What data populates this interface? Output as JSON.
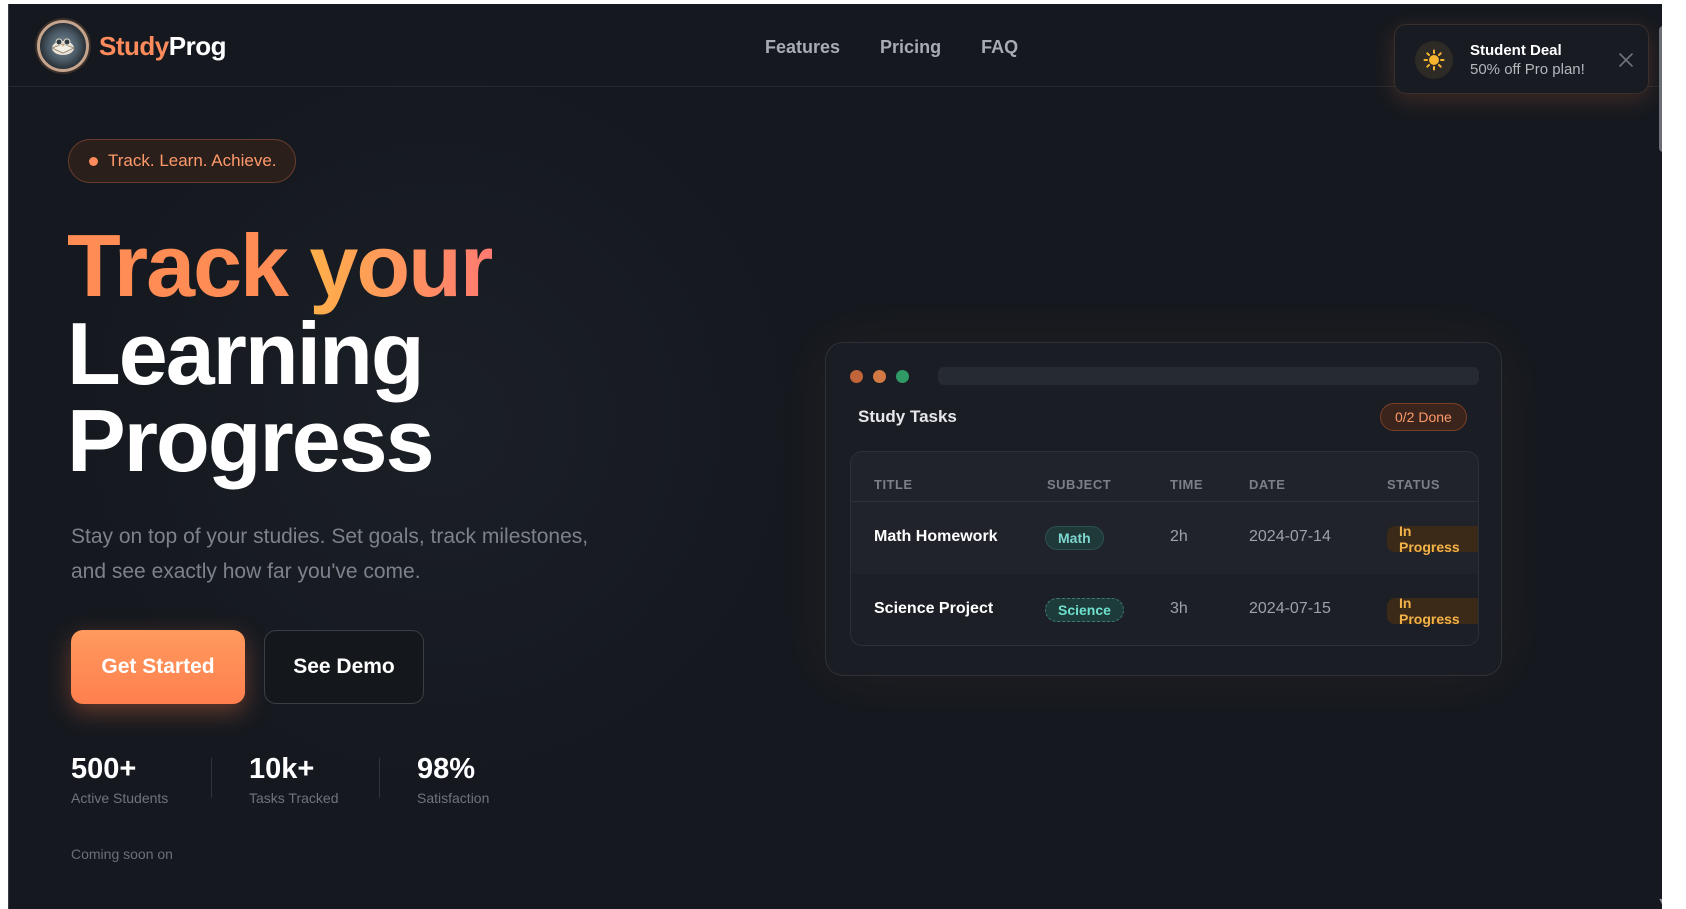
{
  "brand": {
    "part1": "Study",
    "part2": "Prog",
    "logo_icon": "owl-book-icon"
  },
  "nav": [
    "Features",
    "Pricing",
    "FAQ"
  ],
  "deal": {
    "title": "Student Deal",
    "subtitle": "50% off Pro plan!",
    "icon": "sun-icon",
    "close_icon": "close-icon"
  },
  "hero": {
    "pill": "Track. Learn. Achieve.",
    "headline_1a": "Track",
    "headline_1b": "your",
    "headline_2": "Learning",
    "headline_3": "Progress",
    "subtitle": "Stay on top of your studies. Set goals, track milestones, and see exactly how far you've come.",
    "primary_cta": "Get Started",
    "secondary_cta": "See Demo"
  },
  "stats": [
    {
      "value": "500+",
      "label": "Active Students"
    },
    {
      "value": "10k+",
      "label": "Tasks Tracked"
    },
    {
      "value": "98%",
      "label": "Satisfaction"
    }
  ],
  "coming_soon": "Coming soon on",
  "preview": {
    "title": "Study Tasks",
    "done_badge": "0/2 Done",
    "columns": [
      "TITLE",
      "SUBJECT",
      "TIME",
      "DATE",
      "STATUS"
    ],
    "rows": [
      {
        "title": "Math Homework",
        "subject": "Math",
        "time": "2h",
        "date": "2024-07-14",
        "status": "In Progress"
      },
      {
        "title": "Science Project",
        "subject": "Science",
        "time": "3h",
        "date": "2024-07-15",
        "status": "In Progress"
      }
    ]
  },
  "colors": {
    "accent": "#ff8a5b",
    "background": "#15191f",
    "status": "#f4b24a",
    "subject": "#7fd6cf"
  }
}
